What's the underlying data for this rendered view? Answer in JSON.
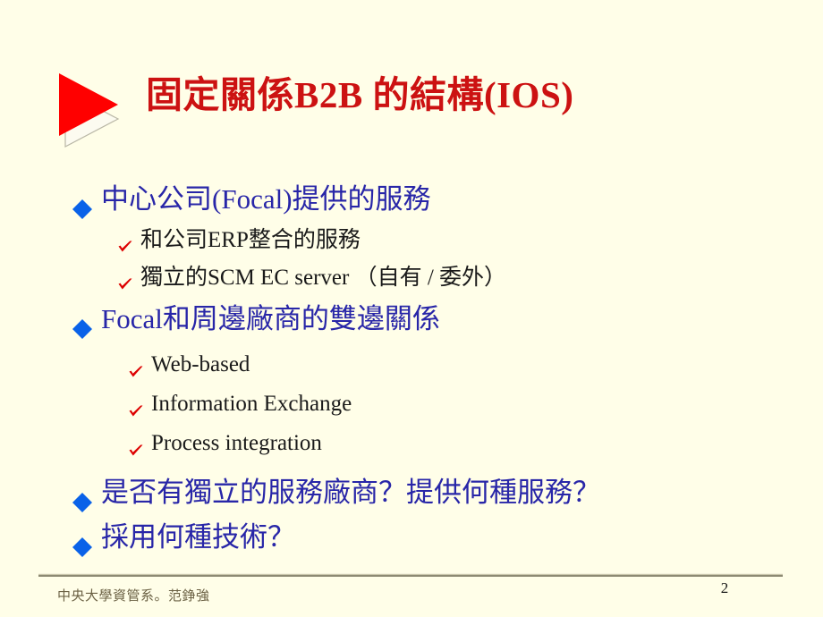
{
  "slide": {
    "title": "固定關係B2B 的結構(IOS)",
    "title_color": "#cc1212",
    "background_color": "#fffee8",
    "marker_icon": "red-right-triangle-with-shadow"
  },
  "colors": {
    "level1_text": "#2826a8",
    "level1_bullet": "#0a62e8",
    "level2_text": "#1a1a1a",
    "level2_bullet": "#dd0000",
    "footer_text": "#6b6144"
  },
  "bullets": [
    {
      "level": 1,
      "icon": "blue-diamond-bullet-icon",
      "text": "中心公司(Focal)提供的服務"
    },
    {
      "level": 2,
      "icon": "red-check-bullet-icon",
      "text": "和公司ERP整合的服務"
    },
    {
      "level": 2,
      "icon": "red-check-bullet-icon",
      "text": "獨立的SCM EC server （自有 / 委外）"
    },
    {
      "level": 1,
      "icon": "blue-diamond-bullet-icon",
      "text": "Focal和周邊廠商的雙邊關係"
    },
    {
      "level": 2,
      "deep": true,
      "icon": "red-check-bullet-icon",
      "text": "Web-based"
    },
    {
      "level": 2,
      "deep": true,
      "icon": "red-check-bullet-icon",
      "text": "Information Exchange"
    },
    {
      "level": 2,
      "deep": true,
      "icon": "red-check-bullet-icon",
      "text": "Process integration"
    },
    {
      "level": 1,
      "icon": "blue-diamond-bullet-icon",
      "text": "是否有獨立的服務廠商？提供何種服務？"
    },
    {
      "level": 1,
      "icon": "blue-diamond-bullet-icon",
      "text": "採用何種技術？"
    }
  ],
  "footer": {
    "credit": "中央大學資管系。范錚強",
    "page_number": "2"
  }
}
